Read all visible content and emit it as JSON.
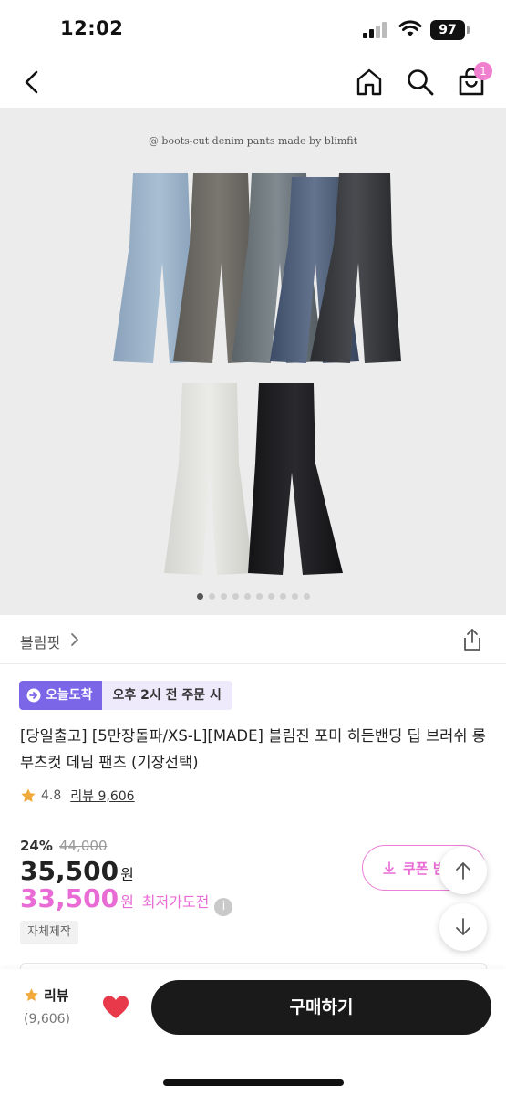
{
  "status_bar": {
    "time": "12:02",
    "battery": "97",
    "icons": [
      "signal-icon",
      "wifi-icon",
      "battery-icon"
    ]
  },
  "nav": {
    "icons": [
      "back-icon",
      "home-icon",
      "search-icon",
      "shopping-bag-icon"
    ],
    "cart_badge": "1",
    "badge_color": "#f07fd0"
  },
  "product_image": {
    "caption": "@ boots-cut denim pants made by blimfit",
    "carousel_total": 10,
    "carousel_active": 1
  },
  "brand": {
    "name": "블림핏",
    "share_icon": "share-icon"
  },
  "delivery": {
    "badge": "오늘도착",
    "text": "오후 2시 전 주문 시",
    "badge_color": "#7b66e8"
  },
  "product": {
    "title": "[당일출고] [5만장돌파/XS-L][MADE] 블림진 포미 히든밴딩 딥 브러쉬 롱 부츠컷 데님 팬츠 (기장선택)",
    "rating": "4.8",
    "review_label": "리뷰 9,606"
  },
  "price": {
    "discount_rate": "24%",
    "original": "44,000",
    "sale": "35,500",
    "currency": "원",
    "lowest": "33,500",
    "lowest_label": "최저가도전",
    "accent_color": "#e96bd5"
  },
  "coupon": {
    "label": "쿠폰 받기"
  },
  "badges": {
    "self_made": "자체제작"
  },
  "bottom_bar": {
    "review_label": "리뷰",
    "review_count": "(9,606)",
    "buy_label": "구매하기",
    "heart_color": "#e8394a"
  }
}
